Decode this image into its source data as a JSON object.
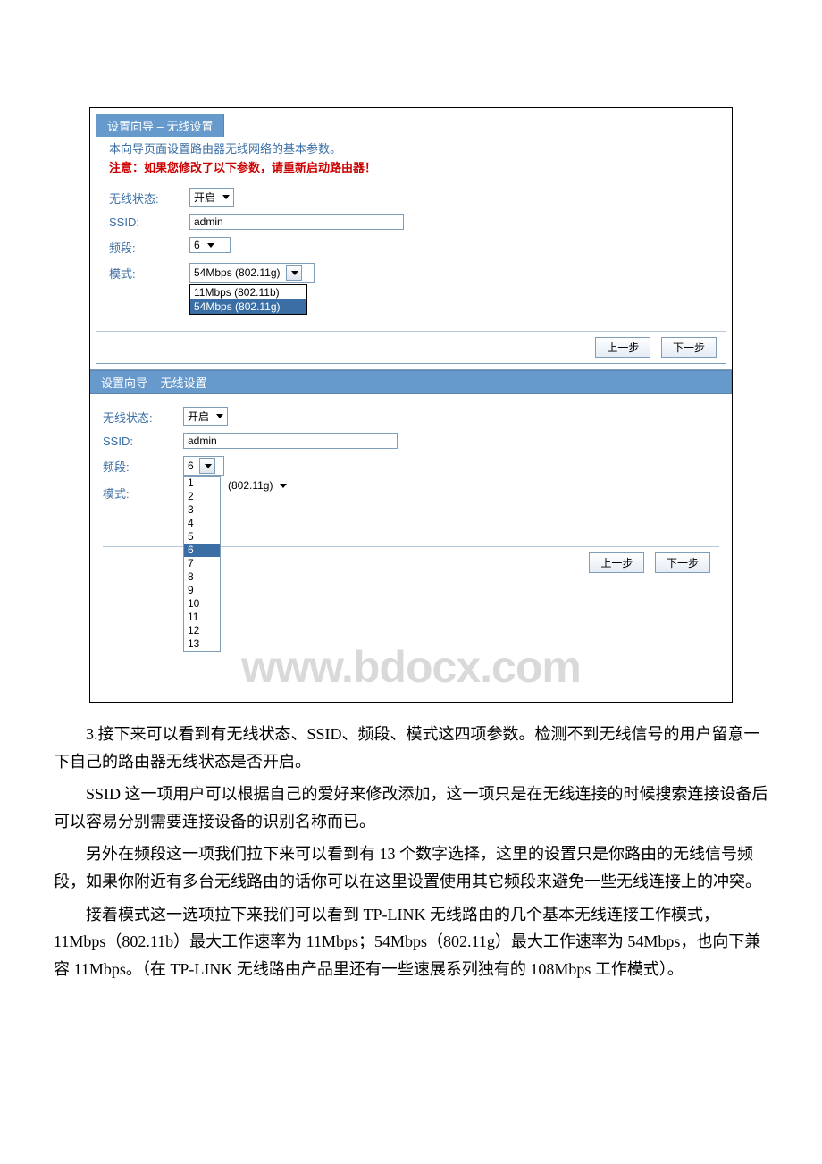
{
  "panel1": {
    "title": "设置向导 – 无线设置",
    "intro": "本向导页面设置路由器无线网络的基本参数。",
    "warn": "注意：如果您修改了以下参数，请重新启动路由器！",
    "labels": {
      "status": "无线状态:",
      "ssid": "SSID:",
      "channel": "频段:",
      "mode": "模式:"
    },
    "values": {
      "status": "开启",
      "ssid": "admin",
      "channel": "6",
      "mode": "54Mbps (802.11g)"
    },
    "mode_options": [
      "11Mbps (802.11b)",
      "54Mbps (802.11g)"
    ],
    "prev": "上一步",
    "next": "下一步"
  },
  "panel2": {
    "title": "设置向导 – 无线设置",
    "labels": {
      "status": "无线状态:",
      "ssid": "SSID:",
      "channel": "频段:",
      "mode": "模式:"
    },
    "values": {
      "status": "开启",
      "ssid": "admin",
      "channel": "6",
      "mode2": "(802.11g)"
    },
    "channel_options": [
      "1",
      "2",
      "3",
      "4",
      "5",
      "6",
      "7",
      "8",
      "9",
      "10",
      "11",
      "12",
      "13"
    ],
    "prev": "上一步",
    "next": "下一步"
  },
  "watermark": "www.bdocx.com",
  "text": {
    "p1": "3.接下来可以看到有无线状态、SSID、频段、模式这四项参数。检测不到无线信号的用户留意一下自己的路由器无线状态是否开启。",
    "p2": "SSID 这一项用户可以根据自己的爱好来修改添加，这一项只是在无线连接的时候搜索连接设备后可以容易分别需要连接设备的识别名称而已。",
    "p3": "另外在频段这一项我们拉下来可以看到有 13 个数字选择，这里的设置只是你路由的无线信号频段，如果你附近有多台无线路由的话你可以在这里设置使用其它频段来避免一些无线连接上的冲突。",
    "p4": "接着模式这一选项拉下来我们可以看到 TP-LINK 无线路由的几个基本无线连接工作模式，11Mbps（802.11b）最大工作速率为 11Mbps；54Mbps（802.11g）最大工作速率为 54Mbps，也向下兼容 11Mbps。（在 TP-LINK 无线路由产品里还有一些速展系列独有的 108Mbps 工作模式）。"
  }
}
